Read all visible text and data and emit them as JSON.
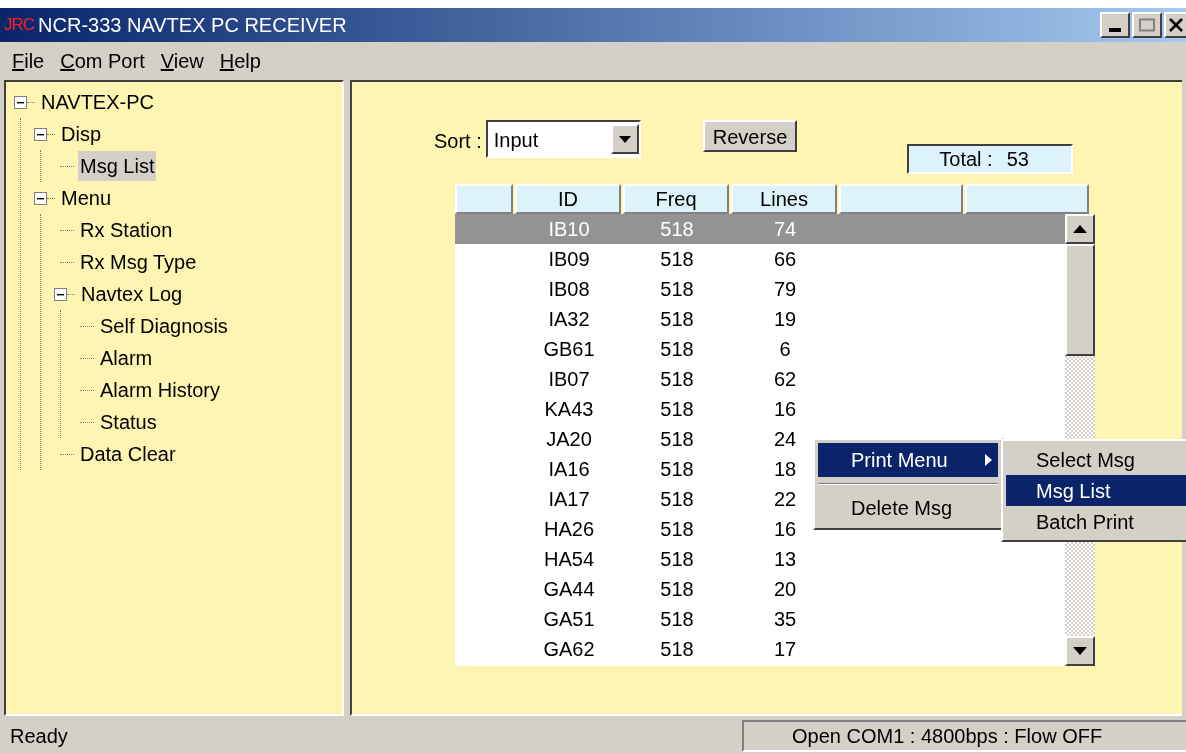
{
  "window": {
    "logo": "JRC",
    "title": "NCR-333 NAVTEX PC RECEIVER"
  },
  "menu_bar": [
    {
      "label": "File"
    },
    {
      "label": "Com Port"
    },
    {
      "label": "View"
    },
    {
      "label": "Help"
    }
  ],
  "tree": [
    {
      "label": "NAVTEX-PC",
      "expanded": true,
      "selected": false,
      "children": [
        {
          "label": "Disp",
          "expanded": true,
          "selected": false,
          "children": [
            {
              "label": "Msg List",
              "selected": true
            }
          ]
        },
        {
          "label": "Menu",
          "expanded": true,
          "selected": false,
          "children": [
            {
              "label": "Rx Station",
              "selected": false
            },
            {
              "label": "Rx Msg Type",
              "selected": false
            },
            {
              "label": "Navtex Log",
              "expanded": true,
              "selected": false,
              "children": [
                {
                  "label": "Self Diagnosis",
                  "selected": false
                },
                {
                  "label": "Alarm",
                  "selected": false
                },
                {
                  "label": "Alarm History",
                  "selected": false
                },
                {
                  "label": "Status",
                  "selected": false
                }
              ]
            },
            {
              "label": "Data Clear",
              "selected": false
            }
          ]
        }
      ]
    }
  ],
  "sort": {
    "label": "Sort :",
    "value": "Input"
  },
  "reverse_button": "Reverse",
  "total": {
    "label": "Total :",
    "value": "53"
  },
  "table": {
    "columns": [
      "ID",
      "Freq",
      "Lines"
    ],
    "rows": [
      {
        "id": "IB10",
        "freq": "518",
        "lines": "74",
        "selected": true
      },
      {
        "id": "IB09",
        "freq": "518",
        "lines": "66",
        "selected": false
      },
      {
        "id": "IB08",
        "freq": "518",
        "lines": "79",
        "selected": false
      },
      {
        "id": "IA32",
        "freq": "518",
        "lines": "19",
        "selected": false
      },
      {
        "id": "GB61",
        "freq": "518",
        "lines": "6",
        "selected": false
      },
      {
        "id": "IB07",
        "freq": "518",
        "lines": "62",
        "selected": false
      },
      {
        "id": "KA43",
        "freq": "518",
        "lines": "16",
        "selected": false
      },
      {
        "id": "JA20",
        "freq": "518",
        "lines": "24",
        "selected": false
      },
      {
        "id": "IA16",
        "freq": "518",
        "lines": "18",
        "selected": false
      },
      {
        "id": "IA17",
        "freq": "518",
        "lines": "22",
        "selected": false
      },
      {
        "id": "HA26",
        "freq": "518",
        "lines": "16",
        "selected": false
      },
      {
        "id": "HA54",
        "freq": "518",
        "lines": "13",
        "selected": false
      },
      {
        "id": "GA44",
        "freq": "518",
        "lines": "20",
        "selected": false
      },
      {
        "id": "GA51",
        "freq": "518",
        "lines": "35",
        "selected": false
      },
      {
        "id": "GA62",
        "freq": "518",
        "lines": "17",
        "selected": false
      }
    ]
  },
  "context_menu": [
    {
      "label": "Print Menu",
      "selected": true,
      "submenu": true
    },
    {
      "label": "Delete Msg",
      "selected": false,
      "submenu": false
    }
  ],
  "submenu": [
    {
      "label": "Select Msg",
      "selected": false
    },
    {
      "label": "Msg List",
      "selected": true
    },
    {
      "label": "Batch Print",
      "selected": false
    }
  ],
  "status_bar": {
    "message": "Ready",
    "port": "Open COM1 : 4800bps : Flow OFF"
  }
}
